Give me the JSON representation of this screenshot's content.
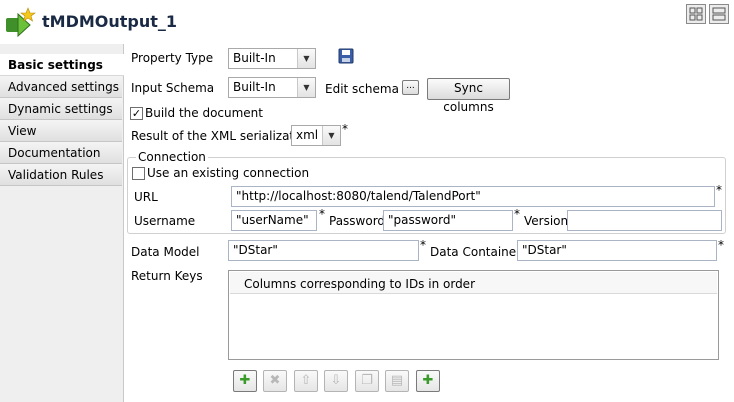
{
  "component": {
    "title": "tMDMOutput_1",
    "icon": "mdm-output-component-icon"
  },
  "view_buttons": [
    "grid-view-icon",
    "list-view-icon"
  ],
  "tabs": [
    {
      "label": "Basic settings",
      "active": true
    },
    {
      "label": "Advanced settings",
      "active": false
    },
    {
      "label": "Dynamic settings",
      "active": false
    },
    {
      "label": "View",
      "active": false
    },
    {
      "label": "Documentation",
      "active": false
    },
    {
      "label": "Validation Rules",
      "active": false
    }
  ],
  "property_type": {
    "label": "Property Type",
    "value": "Built-In",
    "save_icon": "save-icon"
  },
  "input_schema": {
    "label": "Input Schema",
    "value": "Built-In",
    "edit_label": "Edit schema",
    "edit_button": "...",
    "sync_label": "Sync columns"
  },
  "build_document": {
    "label": "Build the document",
    "checked": true
  },
  "xml_serialization": {
    "label": "Result of the XML serialization",
    "value": "xml",
    "required": "*"
  },
  "connection": {
    "title": "Connection",
    "use_existing": {
      "label": "Use an existing connection",
      "checked": false
    },
    "url": {
      "label": "URL",
      "value": "\"http://localhost:8080/talend/TalendPort\"",
      "required": "*"
    },
    "username": {
      "label": "Username",
      "value": "\"userName\"",
      "required": "*"
    },
    "password": {
      "label": "Password",
      "value": "\"password\"",
      "required": "*"
    },
    "version": {
      "label": "Version",
      "value": ""
    }
  },
  "data_model": {
    "label": "Data Model",
    "value": "\"DStar\"",
    "required": "*"
  },
  "data_container": {
    "label": "Data Container",
    "value": "\"DStar\"",
    "required": "*"
  },
  "return_keys": {
    "label": "Return Keys",
    "column_header": "Columns corresponding to IDs in order",
    "toolbar": [
      "add-icon",
      "remove-icon",
      "move-up-icon",
      "move-down-icon",
      "copy-icon",
      "paste-icon",
      "insert-icon"
    ]
  },
  "colors": {
    "accent_green": "#4a9a2a",
    "title_dark": "#1a2a44"
  }
}
